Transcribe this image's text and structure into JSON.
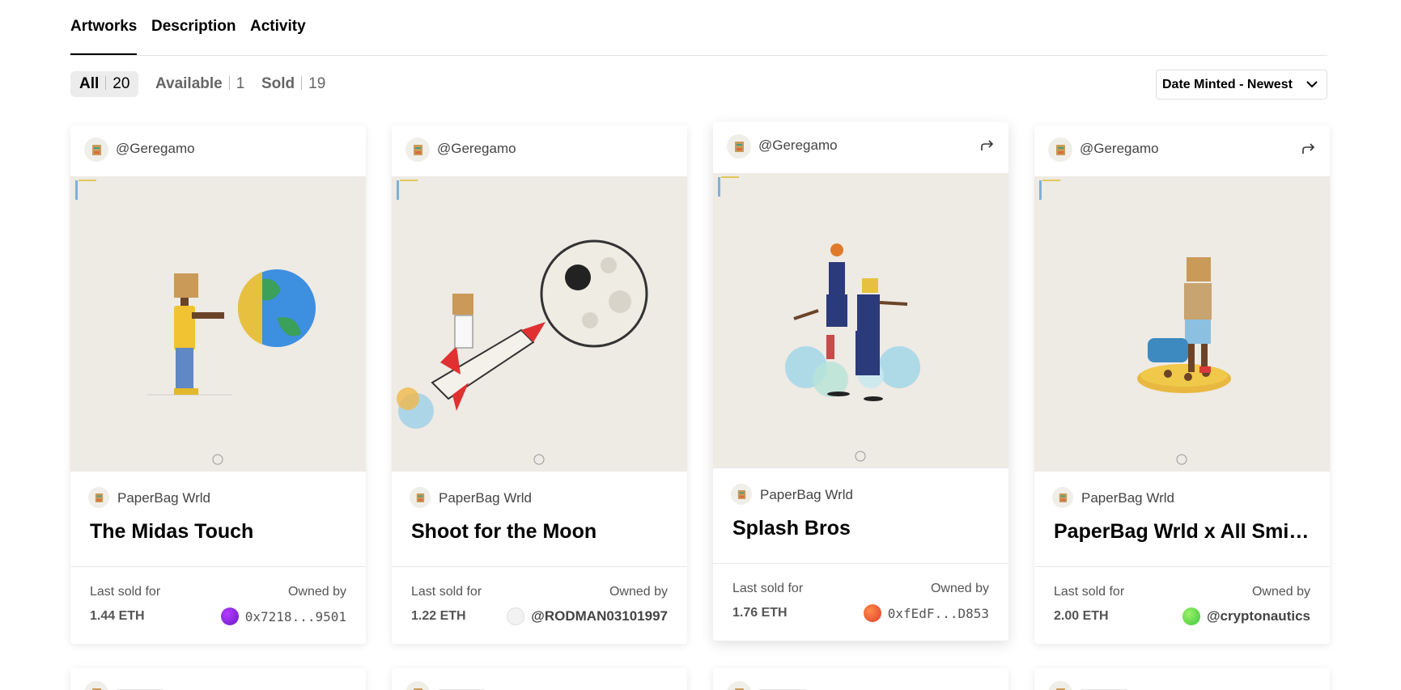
{
  "tabs": [
    {
      "label": "Artworks",
      "active": true
    },
    {
      "label": "Description",
      "active": false
    },
    {
      "label": "Activity",
      "active": false
    }
  ],
  "filters": [
    {
      "label": "All",
      "count": "20",
      "active": true
    },
    {
      "label": "Available",
      "count": "1",
      "active": false
    },
    {
      "label": "Sold",
      "count": "19",
      "active": false
    }
  ],
  "sort": {
    "selected": "Date Minted - Newest",
    "icon": "chevron-down-icon"
  },
  "cards": [
    {
      "creator": "@Geregamo",
      "collection": "PaperBag Wrld",
      "title": "The Midas Touch",
      "last_sold_label": "Last sold for",
      "price": "1.44 ETH",
      "owned_label": "Owned by",
      "owner": "0x7218...9501",
      "owner_color": "#8a2be2",
      "share": false
    },
    {
      "creator": "@Geregamo",
      "collection": "PaperBag Wrld",
      "title": "Shoot for the Moon",
      "last_sold_label": "Last sold for",
      "price": "1.22 ETH",
      "owned_label": "Owned by",
      "owner": "@RODMAN03101997",
      "owner_color": "#c0392b",
      "share": false
    },
    {
      "creator": "@Geregamo",
      "collection": "PaperBag Wrld",
      "title": "Splash Bros",
      "last_sold_label": "Last sold for",
      "price": "1.76 ETH",
      "owned_label": "Owned by",
      "owner": "0xfEdF...D853",
      "owner_color": "#ff6a3d",
      "share": true
    },
    {
      "creator": "@Geregamo",
      "collection": "PaperBag Wrld",
      "title": "PaperBag Wrld x All Smile...",
      "last_sold_label": "Last sold for",
      "price": "2.00 ETH",
      "owned_label": "Owned by",
      "owner": "@cryptonautics",
      "owner_color": "#5be04a",
      "share": true
    }
  ],
  "colors": {
    "accent": "#000000",
    "art_bg": "#eeeae4"
  }
}
